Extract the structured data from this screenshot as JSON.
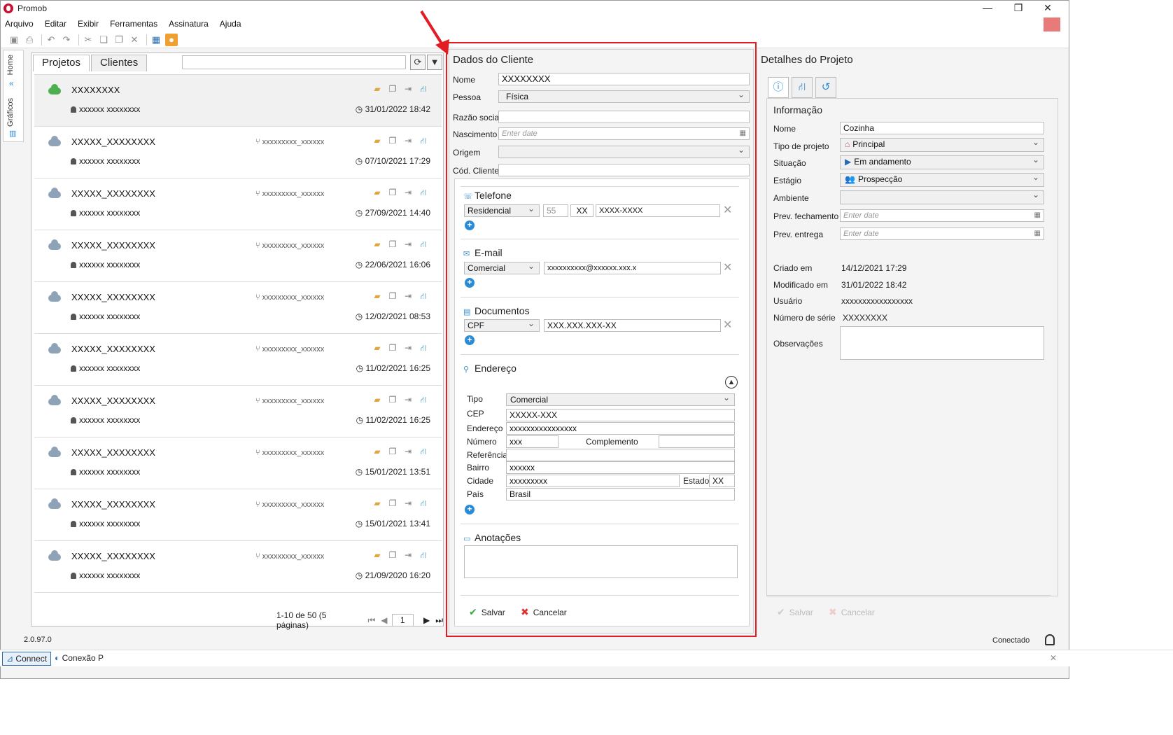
{
  "app": {
    "title": "Promob",
    "version": "2.0.97.0",
    "connection_status": "Conectado"
  },
  "menu": [
    "Arquivo",
    "Editar",
    "Exibir",
    "Ferramentas",
    "Assinatura",
    "Ajuda"
  ],
  "side_tabs": {
    "home": "Home",
    "graficos": "Gráficos"
  },
  "left": {
    "tabs": [
      "Projetos",
      "Clientes"
    ],
    "projects": [
      {
        "name": "XXXXXXXX",
        "owner": "xxxxxx xxxxxxxx",
        "branch": "",
        "date": "31/01/2022 18:42"
      },
      {
        "name": "XXXXX_XXXXXXXX",
        "owner": "xxxxxx xxxxxxxx",
        "branch": "xxxxxxxxx_xxxxxx",
        "date": "07/10/2021 17:29"
      },
      {
        "name": "XXXXX_XXXXXXXX",
        "owner": "xxxxxx xxxxxxxx",
        "branch": "xxxxxxxxx_xxxxxx",
        "date": "27/09/2021 14:40"
      },
      {
        "name": "XXXXX_XXXXXXXX",
        "owner": "xxxxxx xxxxxxxx",
        "branch": "xxxxxxxxx_xxxxxx",
        "date": "22/06/2021 16:06"
      },
      {
        "name": "XXXXX_XXXXXXXX",
        "owner": "xxxxxx xxxxxxxx",
        "branch": "xxxxxxxxx_xxxxxx",
        "date": "12/02/2021 08:53"
      },
      {
        "name": "XXXXX_XXXXXXXX",
        "owner": "xxxxxx xxxxxxxx",
        "branch": "xxxxxxxxx_xxxxxx",
        "date": "11/02/2021 16:25"
      },
      {
        "name": "XXXXX_XXXXXXXX",
        "owner": "xxxxxx xxxxxxxx",
        "branch": "xxxxxxxxx_xxxxxx",
        "date": "11/02/2021 16:25"
      },
      {
        "name": "XXXXX_XXXXXXXX",
        "owner": "xxxxxx xxxxxxxx",
        "branch": "xxxxxxxxx_xxxxxx",
        "date": "15/01/2021 13:51"
      },
      {
        "name": "XXXXX_XXXXXXXX",
        "owner": "xxxxxx xxxxxxxx",
        "branch": "xxxxxxxxx_xxxxxx",
        "date": "15/01/2021 13:41"
      },
      {
        "name": "XXXXX_XXXXXXXX",
        "owner": "xxxxxx xxxxxxxx",
        "branch": "xxxxxxxxx_xxxxxx",
        "date": "21/09/2020 16:20"
      }
    ],
    "pager": {
      "summary": "1-10 de 50 (5 páginas)",
      "page": "1"
    }
  },
  "client": {
    "title": "Dados do Cliente",
    "labels": {
      "nome": "Nome",
      "pessoa": "Pessoa",
      "razao": "Razão social",
      "nascimento": "Nascimento",
      "origem": "Origem",
      "cod": "Cód. Cliente"
    },
    "values": {
      "nome": "XXXXXXXX",
      "pessoa": "Física",
      "nascimento_placeholder": "Enter date"
    },
    "telefone": {
      "title": "Telefone",
      "type": "Residencial",
      "ddi": "55",
      "ddd": "XX",
      "number": "XXXX-XXXX"
    },
    "email": {
      "title": "E-mail",
      "type": "Comercial",
      "value": "xxxxxxxxxx@xxxxxx.xxx.x"
    },
    "documentos": {
      "title": "Documentos",
      "type": "CPF",
      "value": "XXX.XXX.XXX-XX"
    },
    "endereco": {
      "title": "Endereço",
      "labels": {
        "tipo": "Tipo",
        "cep": "CEP",
        "endereco": "Endereço",
        "numero": "Número",
        "complemento": "Complemento",
        "referencia": "Referência",
        "bairro": "Bairro",
        "cidade": "Cidade",
        "estado": "Estado",
        "pais": "País"
      },
      "values": {
        "tipo": "Comercial",
        "cep": "XXXXX-XXX",
        "endereco": "xxxxxxxxxxxxxxxx",
        "numero": "xxx",
        "bairro": "xxxxxx",
        "cidade": "xxxxxxxxx",
        "estado": "XX",
        "pais": "Brasil"
      }
    },
    "anotacoes": {
      "title": "Anotações"
    },
    "actions": {
      "save": "Salvar",
      "cancel": "Cancelar"
    }
  },
  "project": {
    "title": "Detalhes do Projeto",
    "section": "Informação",
    "labels": {
      "nome": "Nome",
      "tipo": "Tipo de projeto",
      "situacao": "Situação",
      "estagio": "Estágio",
      "ambiente": "Ambiente",
      "prev_fech": "Prev. fechamento",
      "prev_ent": "Prev. entrega",
      "criado": "Criado em",
      "modificado": "Modificado em",
      "usuario": "Usuário",
      "serie": "Número de série",
      "obs": "Observações"
    },
    "values": {
      "nome": "Cozinha",
      "tipo": "Principal",
      "situacao": "Em andamento",
      "estagio": "Prospecção",
      "prev_fech": "Enter date",
      "prev_ent": "Enter date",
      "criado": "14/12/2021 17:29",
      "modificado": "31/01/2022 18:42",
      "usuario": "xxxxxxxxxxxxxxxxx",
      "serie": "XXXXXXXX"
    },
    "actions": {
      "save": "Salvar",
      "cancel": "Cancelar"
    }
  },
  "taskbar": {
    "connect": "Connect",
    "conexao": "Conexão P"
  },
  "colors": {
    "highlight": "#e31b23",
    "accent": "#2a8bd6"
  }
}
